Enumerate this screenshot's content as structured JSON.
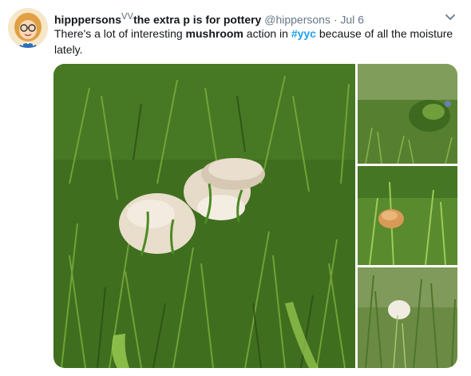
{
  "tweet": {
    "display_name": "hipppersons",
    "name_decoration": "ᐯᐯ",
    "name_suffix": "the extra p is for pottery",
    "handle": "@hippersons",
    "separator": "·",
    "time": "Jul 6",
    "text_part1": "There's a lot of interesting ",
    "text_bold": "mushroom",
    "text_part2": " action in ",
    "hashtag": "#yyc",
    "text_part3": " because of all the moisture lately."
  },
  "icons": {
    "avatar": "cartoon-avatar-icon",
    "caret": "chevron-down-icon"
  },
  "colors": {
    "accent": "#1da1f2",
    "muted": "#657786",
    "text": "#14171a",
    "grass_dark": "#2f5a18",
    "grass_light": "#6c9a35",
    "mushroom_cap": "#e9ddcc"
  }
}
